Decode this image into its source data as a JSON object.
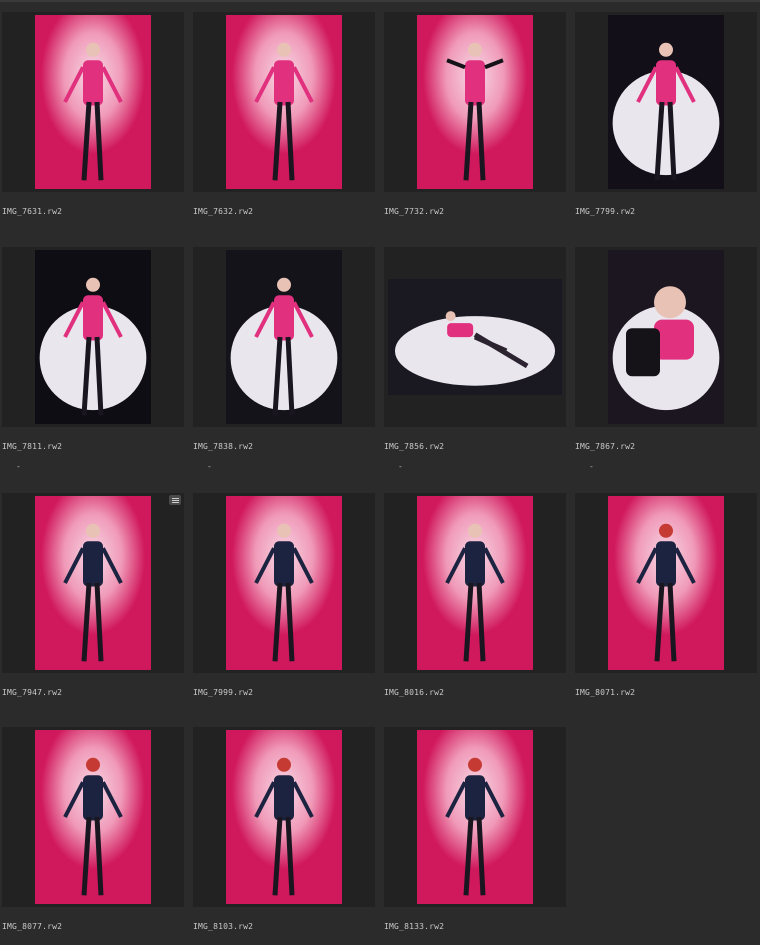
{
  "grid": {
    "items": [
      {
        "filename": "IMG_7631.rw2",
        "bg": "#d0185c",
        "mark": ""
      },
      {
        "filename": "IMG_7632.rw2",
        "bg": "#b0146a",
        "mark": ""
      },
      {
        "filename": "IMG_7732.rw2",
        "bg": "#c8145e",
        "mark": ""
      },
      {
        "filename": "IMG_7799.rw2",
        "bg": "#120f18",
        "mark": ""
      },
      {
        "filename": "IMG_7811.rw2",
        "bg": "#0f0d14",
        "mark": "-"
      },
      {
        "filename": "IMG_7838.rw2",
        "bg": "#15131a",
        "mark": "-"
      },
      {
        "filename": "IMG_7856.rw2",
        "bg": "#1a1820",
        "mark": "-"
      },
      {
        "filename": "IMG_7867.rw2",
        "bg": "#1c1620",
        "mark": "-"
      },
      {
        "filename": "IMG_7947.rw2",
        "bg": "#2a36a8",
        "mark": ""
      },
      {
        "filename": "IMG_7999.rw2",
        "bg": "#1d8fbf",
        "mark": ""
      },
      {
        "filename": "IMG_8016.rw2",
        "bg": "#1c92c8",
        "mark": ""
      },
      {
        "filename": "IMG_8071.rw2",
        "bg": "#1f8fd0",
        "mark": ""
      },
      {
        "filename": "IMG_8077.rw2",
        "bg": "#1f90d0",
        "mark": ""
      },
      {
        "filename": "IMG_8103.rw2",
        "bg": "#1e90cc",
        "mark": ""
      },
      {
        "filename": "IMG_8133.rw2",
        "bg": "#1a86bf",
        "mark": ""
      }
    ]
  },
  "colors": {
    "background": "#2b2b2b",
    "thumb_frame": "#222222",
    "label_text": "#c9c9c9",
    "spot_light": "#eae6ee",
    "outfit_pink": "#e0307e",
    "outfit_dark": "#151218"
  },
  "icons": {
    "edit_badge": "adjustments-icon"
  }
}
